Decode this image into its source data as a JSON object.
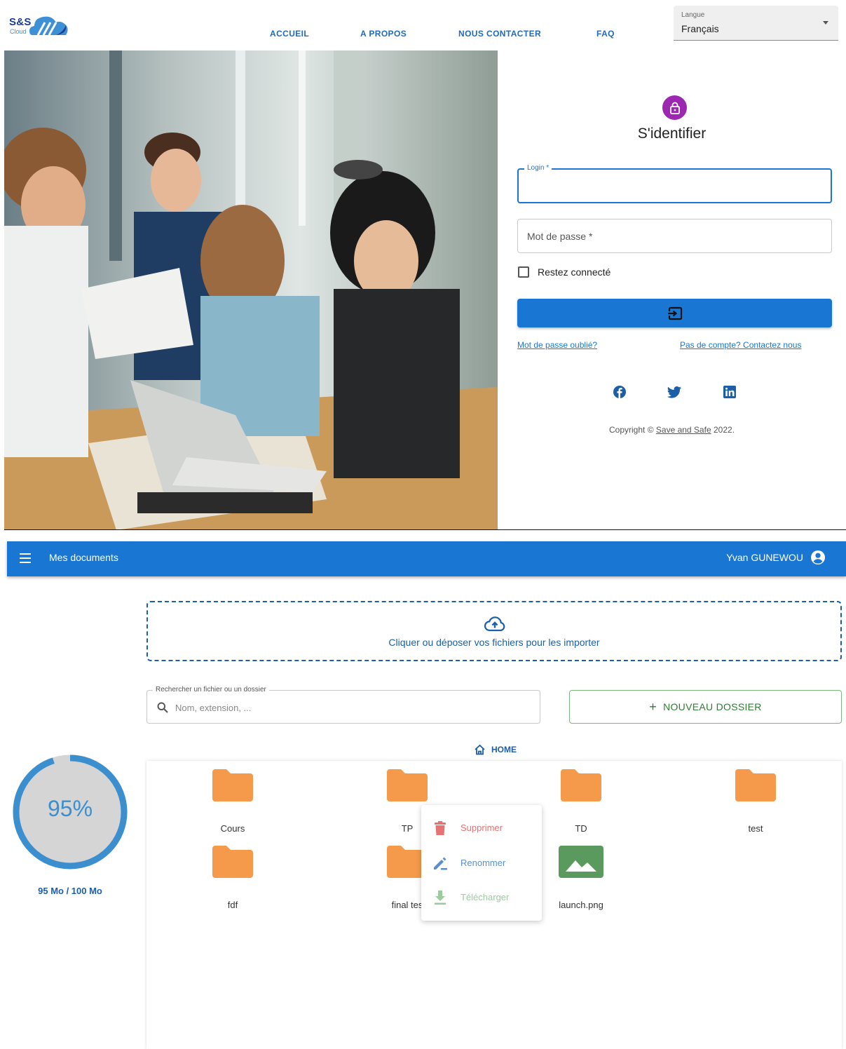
{
  "login_page": {
    "logo": {
      "text": "S&S",
      "sub": "Cloud"
    },
    "nav": [
      {
        "label": "ACCUEIL"
      },
      {
        "label": "A PROPOS"
      },
      {
        "label": "NOUS CONTACTER"
      },
      {
        "label": "FAQ"
      }
    ],
    "language": {
      "label": "Langue",
      "value": "Français"
    },
    "form": {
      "title": "S'identifier",
      "login_label": "Login *",
      "password_placeholder": "Mot de passe *",
      "remember_label": "Restez connecté",
      "forgot_link": "Mot de passe oublié?",
      "no_account_link": "Pas de compte? Contactez nous"
    },
    "social": [
      "facebook-icon",
      "twitter-icon",
      "linkedin-icon"
    ],
    "copyright": {
      "prefix": "Copyright ©",
      "link": "Save and Safe",
      "year": "2022."
    },
    "colors": {
      "primary": "#1976d2",
      "avatar": "#9c27b0"
    }
  },
  "docs_page": {
    "app_bar": {
      "title": "Mes documents",
      "user": "Yvan GUNEWOU"
    },
    "dropzone": {
      "text": "Cliquer ou déposer vos fichiers pour les importer"
    },
    "search": {
      "label": "Rechercher un fichier ou un dossier",
      "placeholder": "Nom, extension, ..."
    },
    "new_folder": {
      "label": "NOUVEAU DOSSIER"
    },
    "breadcrumb": {
      "label": "HOME"
    },
    "quota": {
      "percent_label": "95%",
      "percent": 0.95,
      "usage": "95 Mo / 100 Mo"
    },
    "files": [
      {
        "name": "Cours",
        "type": "folder"
      },
      {
        "name": "TP",
        "type": "folder"
      },
      {
        "name": "TD",
        "type": "folder"
      },
      {
        "name": "test",
        "type": "folder"
      },
      {
        "name": "fdf",
        "type": "folder"
      },
      {
        "name": "final tes",
        "type": "folder"
      },
      {
        "name": "launch.png",
        "type": "image"
      }
    ],
    "context_menu": [
      {
        "label": "Supprimer",
        "color": "#e57373"
      },
      {
        "label": "Renommer",
        "color": "#5c8fd1"
      },
      {
        "label": "Télécharger",
        "color": "#9ccc9e"
      }
    ],
    "colors": {
      "folder": "#f59a4a",
      "image": "#5b9a5e",
      "quota": "#3b8fcf"
    }
  }
}
